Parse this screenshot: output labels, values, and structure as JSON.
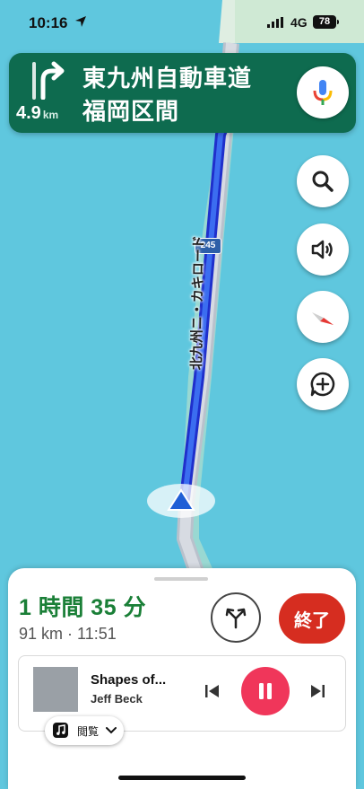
{
  "status_bar": {
    "time": "10:16",
    "network": "4G",
    "battery": "78"
  },
  "nav_banner": {
    "distance_value": "4.9",
    "distance_unit": "km",
    "road_line1": "東九州自動車道",
    "road_line2": "福岡区間",
    "turn_icon": "turn-right-arrow-icon",
    "mic_icon": "microphone-icon"
  },
  "map": {
    "route_number": "245",
    "road_name": "北九州ニ・カキロード"
  },
  "side_buttons": [
    "search-icon",
    "volume-icon",
    "compass-icon",
    "report-add-icon"
  ],
  "trip": {
    "eta_duration": "1 時間 35 分",
    "distance_and_arrival": "91 km · 11:51",
    "end_label": "終了",
    "alt_route_icon": "alternate-route-icon"
  },
  "media": {
    "song_title": "Shapes of...",
    "artist": "Jeff Beck",
    "browse_label": "閲覧",
    "state": "playing"
  },
  "colors": {
    "banner_green": "#0e6b4f",
    "eta_green": "#1a7f37",
    "end_red": "#d62d20",
    "pause_pink": "#f0365a",
    "route_blue": "#1a3fe0",
    "water": "#5fc7de"
  }
}
